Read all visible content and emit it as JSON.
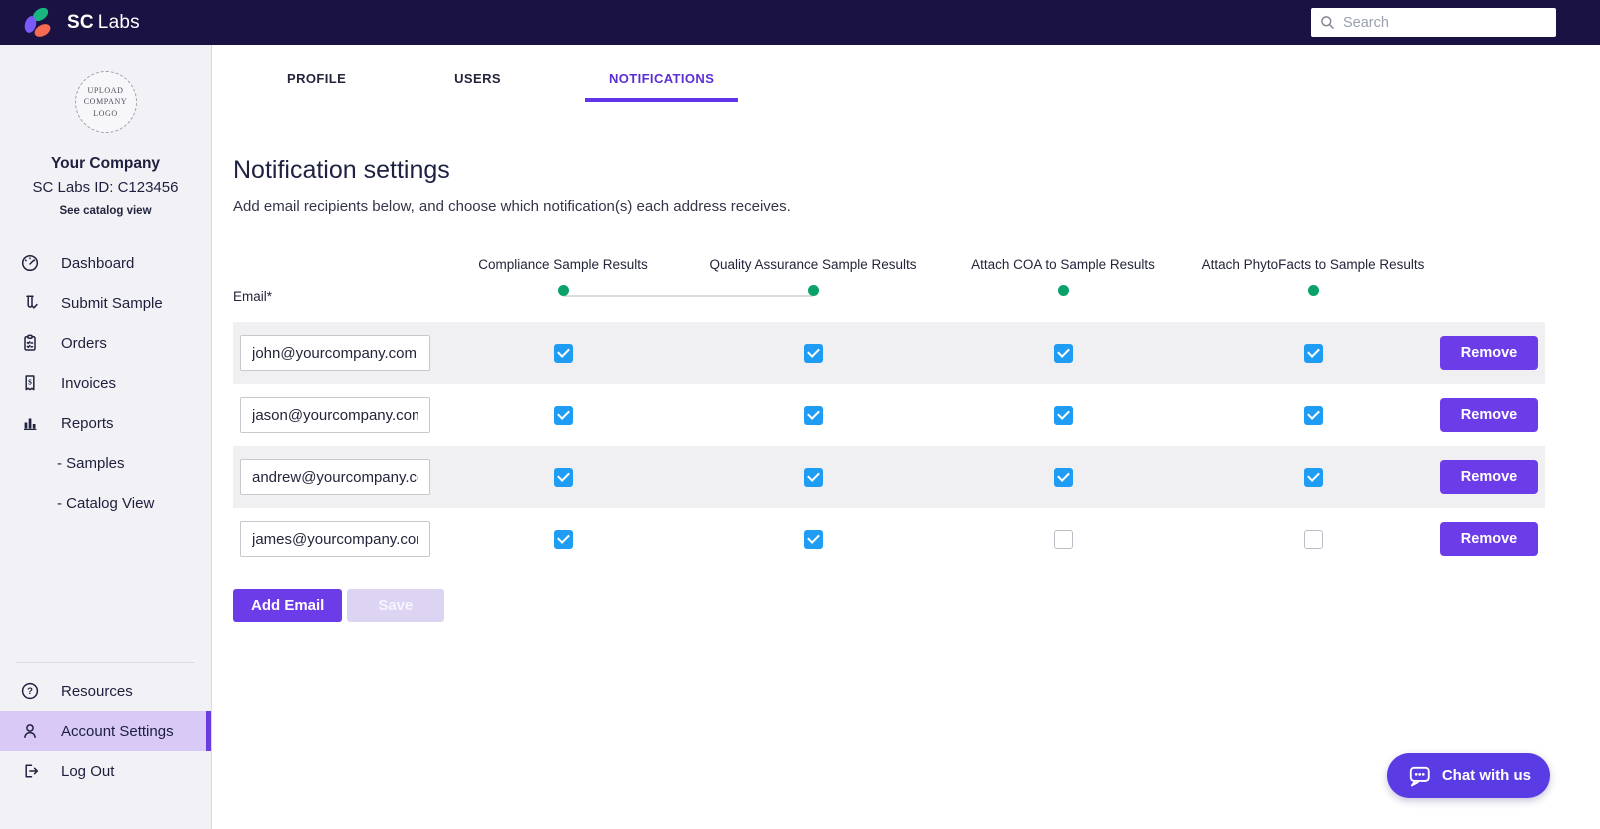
{
  "topbar": {
    "brand_bold": "SC",
    "brand_rest": "Labs",
    "search_placeholder": "Search"
  },
  "sidebar": {
    "upload_logo_text": "UPLOAD COMPANY LOGO",
    "company_name": "Your Company",
    "company_id": "SC Labs ID: C123456",
    "catalog_link": "See catalog view",
    "items": [
      {
        "label": "Dashboard",
        "icon": "gauge-icon"
      },
      {
        "label": "Submit Sample",
        "icon": "test-tube-icon"
      },
      {
        "label": "Orders",
        "icon": "clipboard-icon"
      },
      {
        "label": "Invoices",
        "icon": "invoice-icon"
      },
      {
        "label": "Reports",
        "icon": "bar-chart-icon"
      },
      {
        "label": "- Samples",
        "sub": true
      },
      {
        "label": "- Catalog View",
        "sub": true
      }
    ],
    "bottom_items": [
      {
        "label": "Resources",
        "icon": "help-icon",
        "active": false
      },
      {
        "label": "Account Settings",
        "icon": "user-icon",
        "active": true
      },
      {
        "label": "Log Out",
        "icon": "logout-icon",
        "active": false
      }
    ]
  },
  "tabs": [
    {
      "label": "PROFILE",
      "active": false
    },
    {
      "label": "USERS",
      "active": false
    },
    {
      "label": "NOTIFICATIONS",
      "active": true
    }
  ],
  "main": {
    "title": "Notification settings",
    "subtitle": "Add email recipients below, and choose which notification(s) each address receives.",
    "email_label": "Email*",
    "columns": [
      "Compliance Sample Results",
      "Quality Assurance Sample Results",
      "Attach COA to Sample Results",
      "Attach PhytoFacts to Sample Results"
    ],
    "rows": [
      {
        "email": "john@yourcompany.com",
        "checks": [
          true,
          true,
          true,
          true
        ]
      },
      {
        "email": "jason@yourcompany.com",
        "checks": [
          true,
          true,
          true,
          true
        ]
      },
      {
        "email": "andrew@yourcompany.com",
        "checks": [
          true,
          true,
          true,
          true
        ]
      },
      {
        "email": "james@yourcompany.com",
        "checks": [
          true,
          true,
          false,
          false
        ]
      }
    ],
    "remove_label": "Remove",
    "add_email_label": "Add Email",
    "save_label": "Save"
  },
  "chat": {
    "label": "Chat with us"
  },
  "colors": {
    "topbar_bg": "#1a1242",
    "accent_purple": "#6c3ce9",
    "active_item_bg": "#d9c9f7",
    "checkbox_blue": "#1f9cf3",
    "toggle_green": "#0aa268",
    "sidebar_bg": "#f2f2f6",
    "row_stripe": "#f0f0f2",
    "tab_active": "#5b2ed6"
  }
}
